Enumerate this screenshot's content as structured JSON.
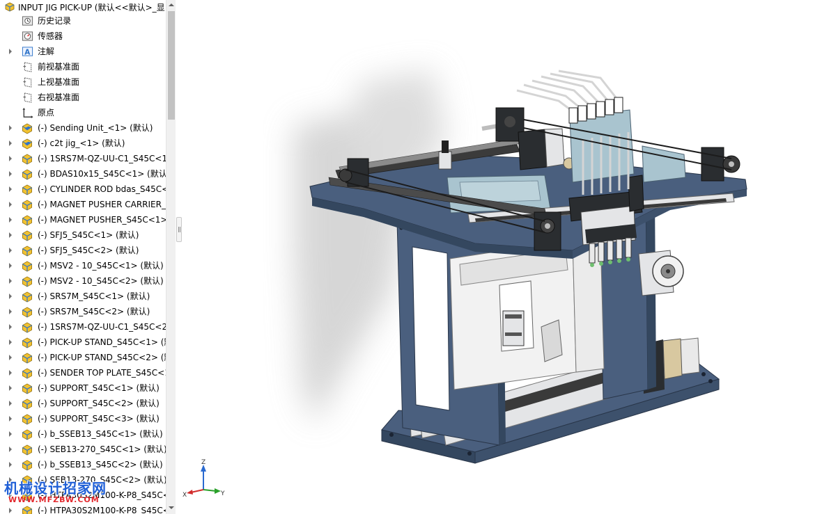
{
  "feature_tree": {
    "root_label": "INPUT JIG PICK-UP  (默认<<默认>_显",
    "rows": [
      {
        "label": "历史记录",
        "icon": "history-folder-icon",
        "kind": "ref",
        "expandable": false
      },
      {
        "label": "传感器",
        "icon": "sensor-icon",
        "kind": "ref",
        "expandable": false
      },
      {
        "label": "注解",
        "icon": "annotation-icon",
        "kind": "ref",
        "expandable": true
      },
      {
        "label": "前视基准面",
        "icon": "plane-icon",
        "kind": "ref",
        "expandable": false
      },
      {
        "label": "上视基准面",
        "icon": "plane-icon",
        "kind": "ref",
        "expandable": false
      },
      {
        "label": "右视基准面",
        "icon": "plane-icon",
        "kind": "ref",
        "expandable": false
      },
      {
        "label": "原点",
        "icon": "origin-icon",
        "kind": "ref",
        "expandable": false
      },
      {
        "label": "(-) Sending Unit_<1> (默认)",
        "icon": "subassembly-icon",
        "kind": "part",
        "expandable": true
      },
      {
        "label": "(-) c2t jig_<1> (默认)",
        "icon": "subassembly-icon",
        "kind": "part",
        "expandable": true
      },
      {
        "label": "(-) 1SRS7M-QZ-UU-C1_S45C<1",
        "icon": "part-icon",
        "kind": "part",
        "expandable": true
      },
      {
        "label": "(-) BDAS10x15_S45C<1> (默认)",
        "icon": "part-icon",
        "kind": "part",
        "expandable": true
      },
      {
        "label": "(-) CYLINDER ROD bdas_S45C<",
        "icon": "part-icon",
        "kind": "part",
        "expandable": true
      },
      {
        "label": "(-) MAGNET PUSHER CARRIER_",
        "icon": "part-icon",
        "kind": "part",
        "expandable": true
      },
      {
        "label": "(-) MAGNET PUSHER_S45C<1>",
        "icon": "part-icon",
        "kind": "part",
        "expandable": true
      },
      {
        "label": "(-) SFJ5_S45C<1> (默认)",
        "icon": "part-icon",
        "kind": "part",
        "expandable": true
      },
      {
        "label": "(-) SFJ5_S45C<2> (默认)",
        "icon": "part-icon",
        "kind": "part",
        "expandable": true
      },
      {
        "label": "(-) MSV2 - 10_S45C<1> (默认)",
        "icon": "part-icon",
        "kind": "part",
        "expandable": true
      },
      {
        "label": "(-) MSV2 - 10_S45C<2> (默认)",
        "icon": "part-icon",
        "kind": "part",
        "expandable": true
      },
      {
        "label": "(-) SRS7M_S45C<1> (默认)",
        "icon": "part-icon",
        "kind": "part",
        "expandable": true
      },
      {
        "label": "(-) SRS7M_S45C<2> (默认)",
        "icon": "part-icon",
        "kind": "part",
        "expandable": true
      },
      {
        "label": "(-) 1SRS7M-QZ-UU-C1_S45C<2",
        "icon": "part-icon",
        "kind": "part",
        "expandable": true
      },
      {
        "label": "(-) PICK-UP STAND_S45C<1> (默",
        "icon": "part-icon",
        "kind": "part",
        "expandable": true
      },
      {
        "label": "(-) PICK-UP STAND_S45C<2> (默",
        "icon": "part-icon",
        "kind": "part",
        "expandable": true
      },
      {
        "label": "(-) SENDER TOP PLATE_S45C<1",
        "icon": "part-icon",
        "kind": "part",
        "expandable": true
      },
      {
        "label": "(-) SUPPORT_S45C<1> (默认)",
        "icon": "part-icon",
        "kind": "part",
        "expandable": true
      },
      {
        "label": "(-) SUPPORT_S45C<2> (默认)",
        "icon": "part-icon",
        "kind": "part",
        "expandable": true
      },
      {
        "label": "(-) SUPPORT_S45C<3> (默认)",
        "icon": "part-icon",
        "kind": "part",
        "expandable": true
      },
      {
        "label": "(-) b_SSEB13_S45C<1> (默认)",
        "icon": "part-icon",
        "kind": "part",
        "expandable": true
      },
      {
        "label": "(-) SEB13-270_S45C<1> (默认)",
        "icon": "part-icon",
        "kind": "part",
        "expandable": true
      },
      {
        "label": "(-) b_SSEB13_S45C<2> (默认)",
        "icon": "part-icon",
        "kind": "part",
        "expandable": true
      },
      {
        "label": "(-) SEB13-270_S45C<2> (默认)",
        "icon": "part-icon",
        "kind": "part",
        "expandable": true
      },
      {
        "label": "(-) HTPA30S2M100-K-P8_S45C<",
        "icon": "part-icon",
        "kind": "part",
        "expandable": true
      },
      {
        "label": "(-) HTPA30S2M100-K-P8_S45C<",
        "icon": "part-icon",
        "kind": "part",
        "expandable": true
      }
    ]
  },
  "triad": {
    "x_label": "X",
    "y_label": "Y",
    "z_label": "Z"
  },
  "watermark": {
    "title": "机械设计招家网",
    "url": "WWW.MFZBW.COM"
  },
  "colors": {
    "plate_blue": "#4a5f7e",
    "plate_blue_dark": "#34475f",
    "plate_edge": "#283548",
    "frame_light": "#e4e5e7",
    "block_dark": "#2a2d30",
    "pale_blue": "#a9c4cf",
    "shadow": "#c9c9c9",
    "tree_icon_yellow": "#f2c230",
    "tree_icon_blue": "#2f74c9",
    "watermark_blue": "#1f5fd6",
    "watermark_red": "#e2282d"
  }
}
